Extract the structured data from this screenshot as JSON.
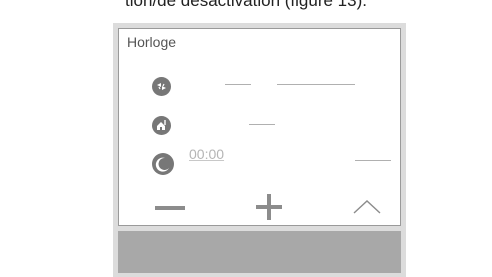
{
  "caption": "tion/de désactivation (figure 13).",
  "screen": {
    "title": "Horloge",
    "time_value": "00:00"
  },
  "icons": {
    "row1": "comfort-mode-icon",
    "row2": "reduced-mode-icon",
    "row3": "moon-icon",
    "minus": "minus-icon",
    "plus": "plus-icon",
    "up": "chevron-up-icon"
  },
  "colors": {
    "frame": "#dcdcdc",
    "screen": "#ffffff",
    "badge": "#777777",
    "bottom_bar": "#a8a8a8"
  }
}
